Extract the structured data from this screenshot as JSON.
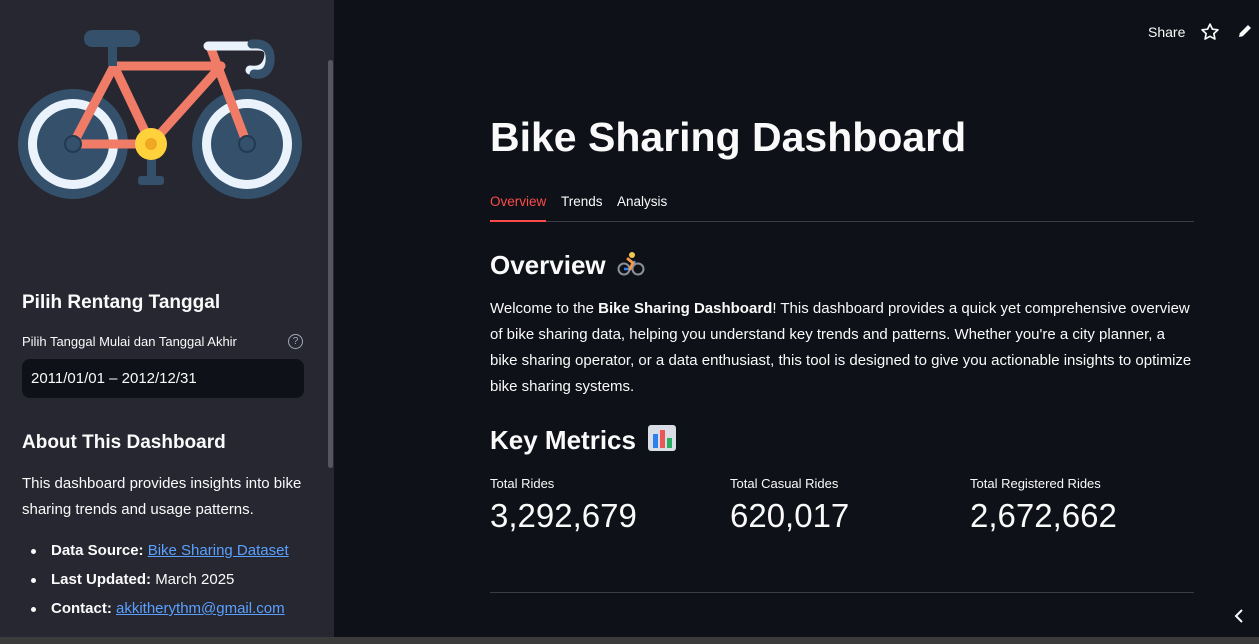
{
  "header": {
    "share_label": "Share"
  },
  "sidebar": {
    "date_section_title": "Pilih Rentang Tanggal",
    "date_label": "Pilih Tanggal Mulai dan Tanggal Akhir",
    "help_glyph": "?",
    "date_value": "2011/01/01 – 2012/12/31",
    "about_title": "About This Dashboard",
    "about_text": "This dashboard provides insights into bike sharing trends and usage patterns.",
    "info": [
      {
        "key": "Data Source:",
        "value": "Bike Sharing Dataset"
      },
      {
        "key": "Last Updated:",
        "value": "March 2025"
      },
      {
        "key": "Contact:",
        "value": "akkitherythm@gmail.com"
      }
    ]
  },
  "main": {
    "title": "Bike Sharing Dashboard",
    "tabs": [
      {
        "label": "Overview"
      },
      {
        "label": "Trends"
      },
      {
        "label": "Analysis"
      }
    ],
    "overview_heading": "Overview",
    "intro": {
      "part1": "Welcome to the ",
      "bold": "Bike Sharing Dashboard",
      "part2": "! This dashboard provides a quick yet comprehensive overview of bike sharing data, helping you understand key trends and patterns. Whether you're a city planner, a bike sharing operator, or a data enthusiast, this tool is designed to give you actionable insights to optimize bike sharing systems."
    },
    "metrics_heading": "Key Metrics",
    "metrics": [
      {
        "label": "Total Rides",
        "value": "3,292,679"
      },
      {
        "label": "Total Casual Rides",
        "value": "620,017"
      },
      {
        "label": "Total Registered Rides",
        "value": "2,672,662"
      }
    ]
  },
  "icons": {
    "logo": "bicycle-icon",
    "overview": "cyclist-emoji",
    "metrics": "bar-chart-emoji",
    "star": "star-icon",
    "edit": "pencil-icon",
    "collapse": "chevron-left-icon"
  },
  "colors": {
    "background": "#0e1117",
    "sidebar": "#262730",
    "accent": "#ff4b4b",
    "link": "#5aa0ff"
  }
}
